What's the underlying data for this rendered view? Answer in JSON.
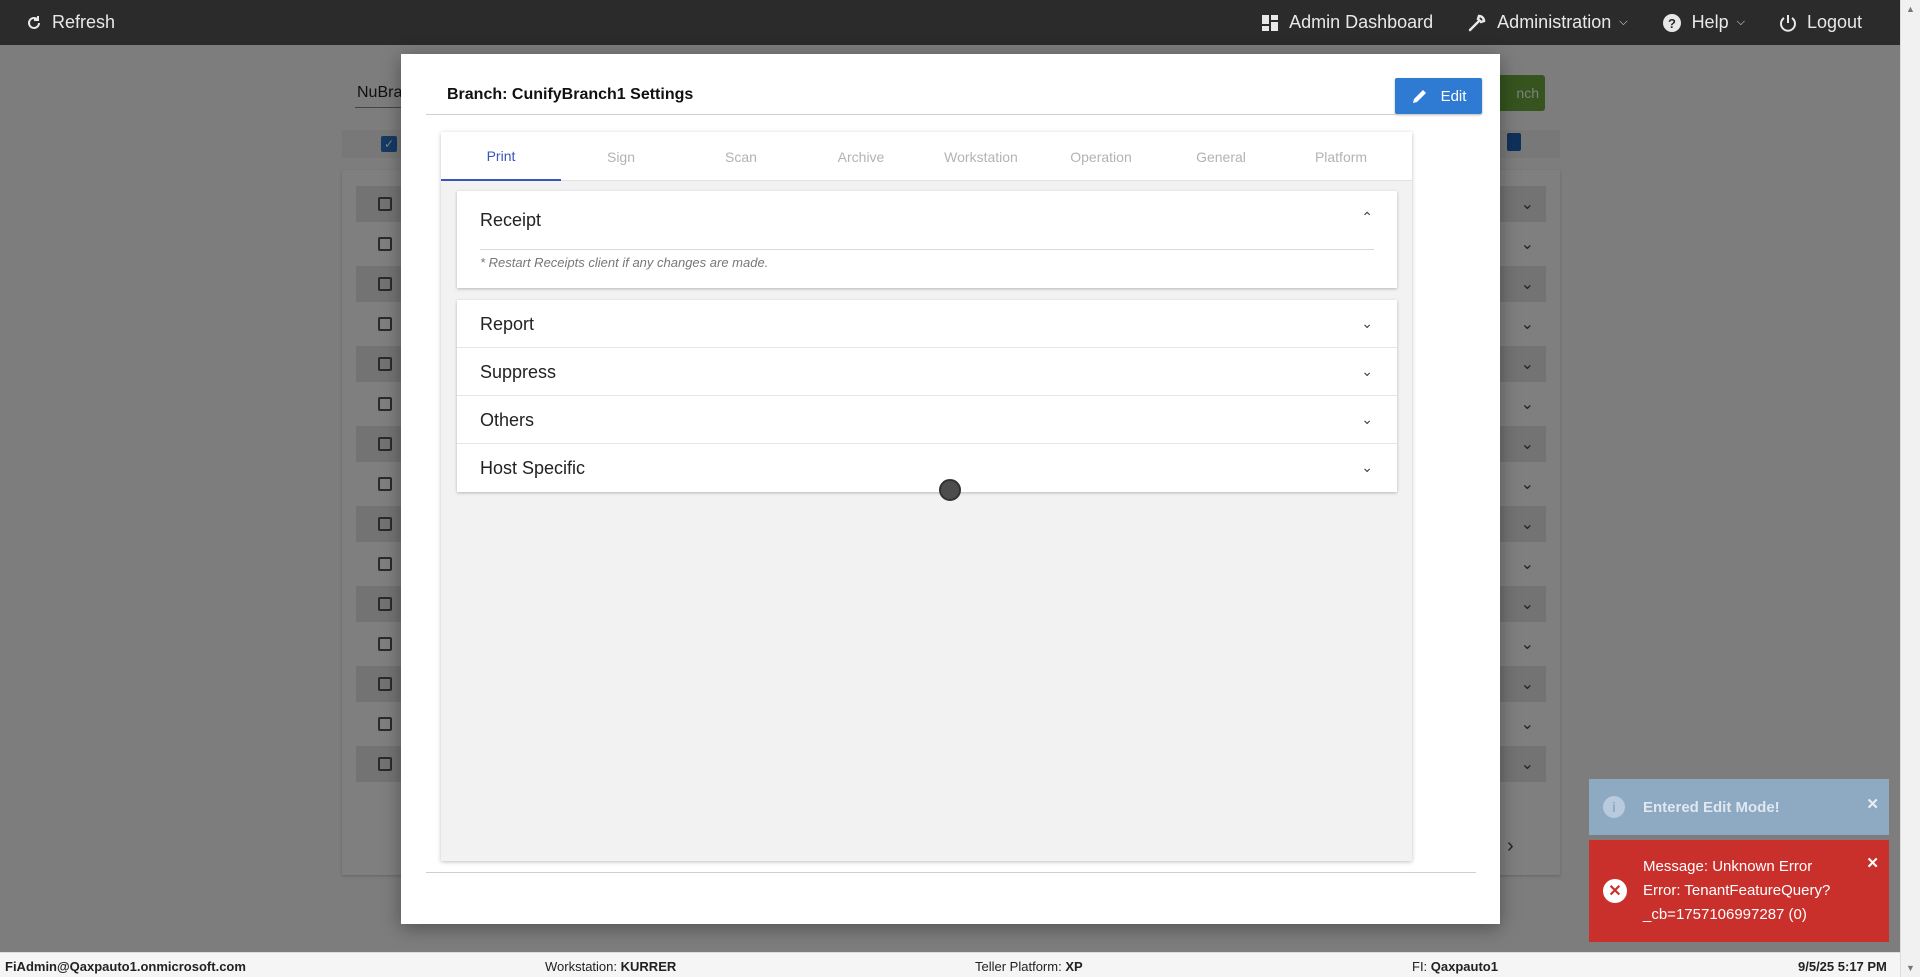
{
  "topbar": {
    "refresh_label": "Refresh",
    "nav": [
      {
        "label": "Admin Dashboard",
        "icon": "dashboard-icon"
      },
      {
        "label": "Administration",
        "icon": "wrench-icon",
        "dropdown": true
      },
      {
        "label": "Help",
        "icon": "help-icon",
        "dropdown": true
      },
      {
        "label": "Logout",
        "icon": "power-icon"
      }
    ]
  },
  "background": {
    "search_value": "NuBra",
    "green_button_label": "nch",
    "row_count": 15
  },
  "modal": {
    "title": "Branch: CunifyBranch1 Settings",
    "edit_label": "Edit",
    "tabs": [
      "Print",
      "Sign",
      "Scan",
      "Archive",
      "Workstation",
      "Operation",
      "General",
      "Platform"
    ],
    "active_tab": "Print",
    "receipt": {
      "title": "Receipt",
      "note": "* Restart Receipts client if any changes are made."
    },
    "sections": [
      "Report",
      "Suppress",
      "Others",
      "Host Specific"
    ]
  },
  "toasts": {
    "info": {
      "text": "Entered Edit Mode!",
      "color": "#8eaac3"
    },
    "error": {
      "line1": "Message: Unknown Error",
      "line2": "Error: TenantFeatureQuery?",
      "line3": "_cb=1757106997287 (0)",
      "color": "#c9302c"
    }
  },
  "statusbar": {
    "user": "FiAdmin@Qaxpauto1.onmicrosoft.com",
    "workstation_label": "Workstation:",
    "workstation_value": "KURRER",
    "platform_label": "Teller Platform:",
    "platform_value": "XP",
    "fi_label": "FI:",
    "fi_value": "Qaxpauto1",
    "datetime": "9/5/25 5:17 PM"
  },
  "colors": {
    "accent": "#2f7bd4",
    "tab_active": "#3a55b9",
    "topbar": "#2b2b2b"
  }
}
